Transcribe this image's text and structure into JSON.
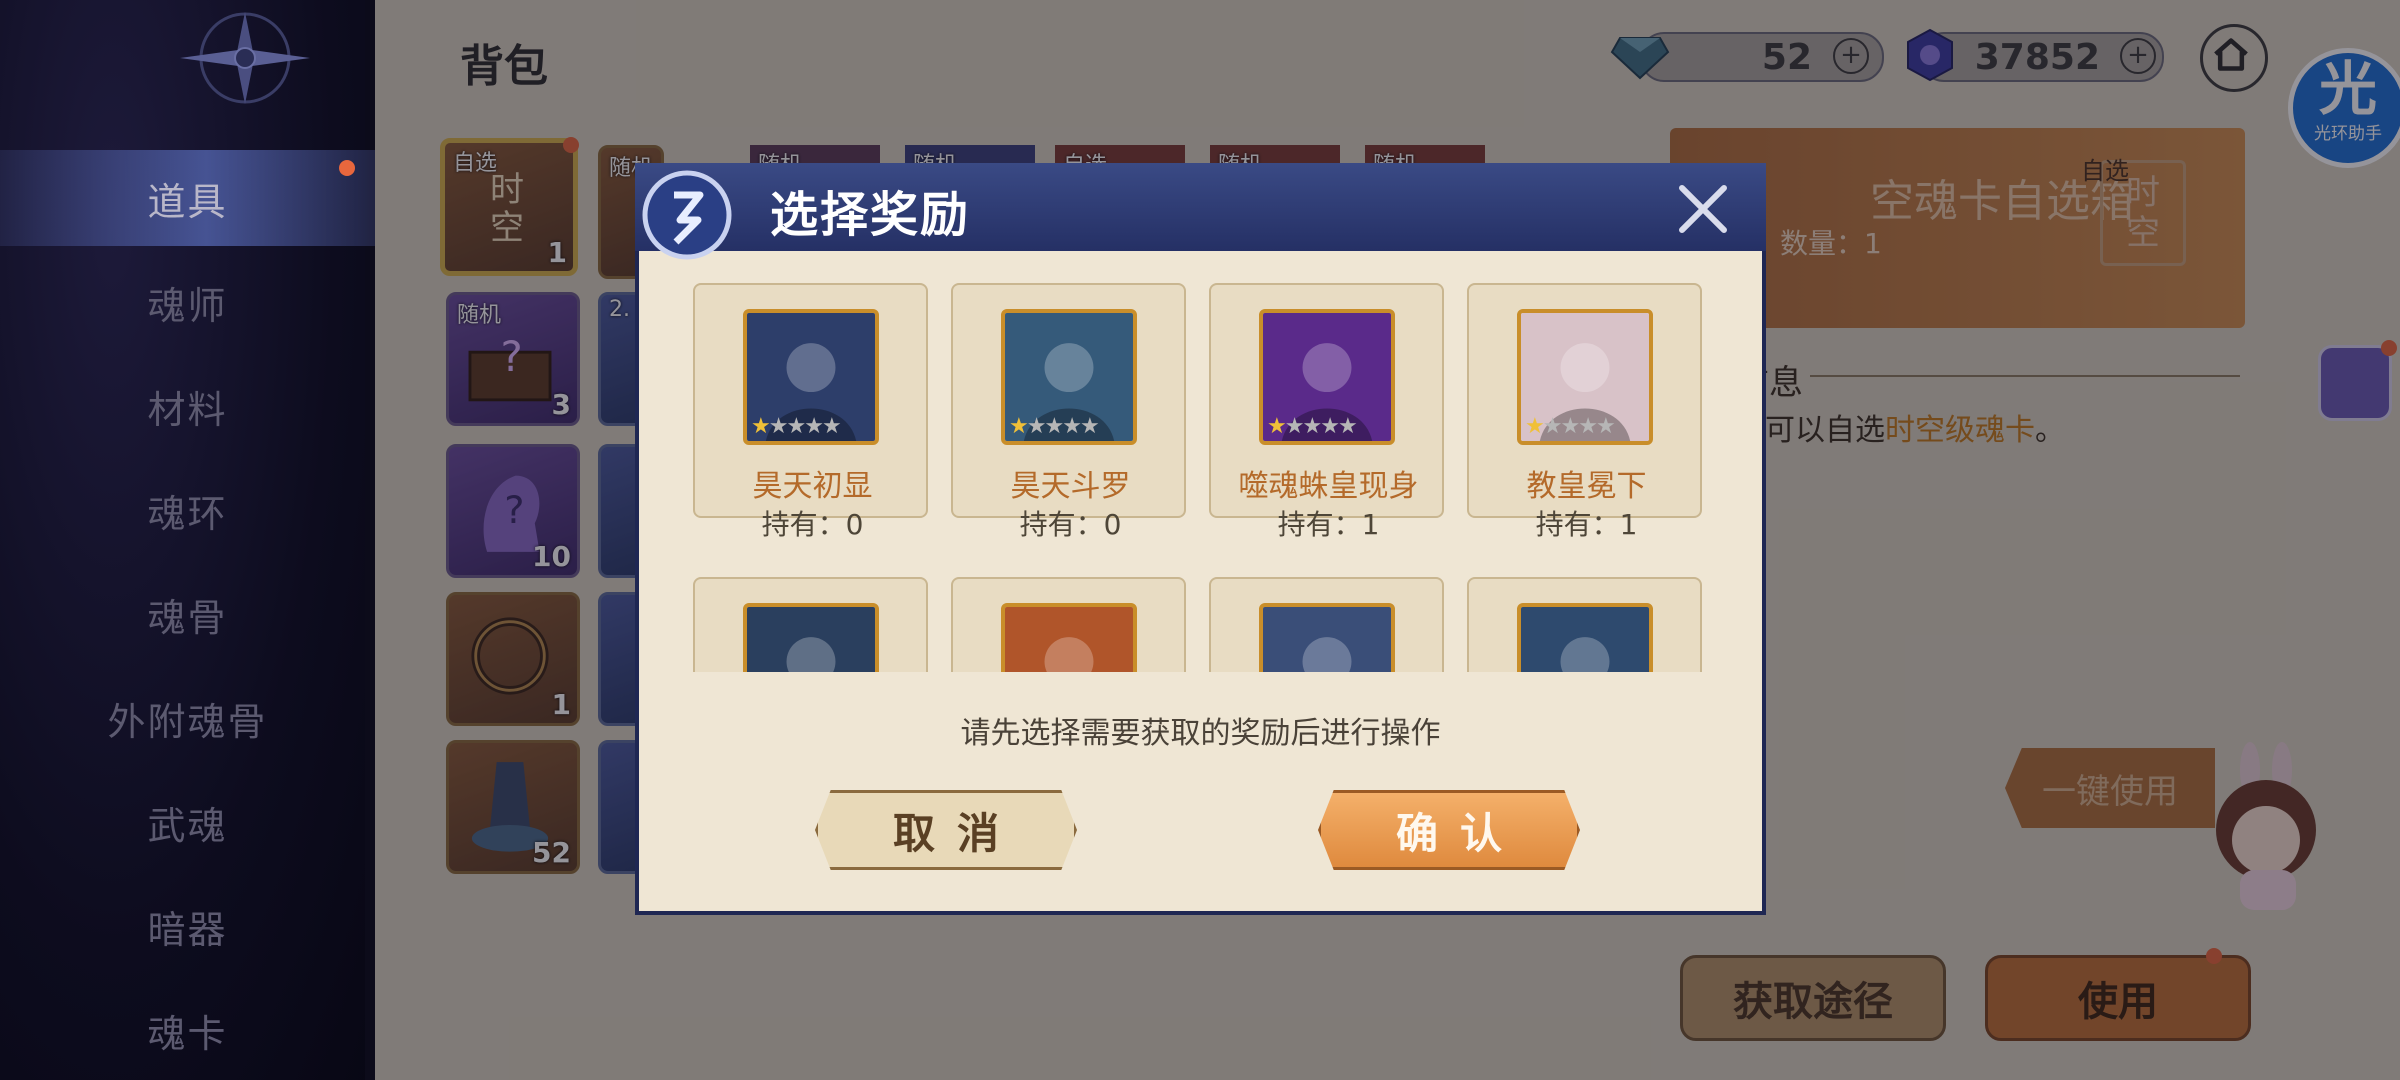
{
  "header": {
    "title": "背包"
  },
  "currency": [
    {
      "name": "diamond",
      "value": "52"
    },
    {
      "name": "soul-coin",
      "value": "37852"
    }
  ],
  "sidebar": {
    "items": [
      {
        "label": "道具",
        "active": true,
        "dot": true
      },
      {
        "label": "魂师"
      },
      {
        "label": "材料"
      },
      {
        "label": "魂环"
      },
      {
        "label": "魂骨"
      },
      {
        "label": "外附魂骨"
      },
      {
        "label": "武魂"
      },
      {
        "label": "暗器"
      },
      {
        "label": "魂卡"
      }
    ]
  },
  "inventory": {
    "items": [
      {
        "tag": "自选",
        "glyph": "时空",
        "count": "1"
      },
      {
        "tag": "随机"
      },
      {
        "tag": "随机",
        "count": "3"
      },
      {
        "tag": "",
        "count": "10"
      },
      {
        "tag": "",
        "count": "1"
      },
      {
        "tag": "",
        "count": "52"
      }
    ],
    "top_tags": [
      "随机",
      "随机",
      "随机",
      "自选",
      "随机",
      "随机"
    ],
    "partial": "2."
  },
  "detail": {
    "title": "空魂卡自选箱",
    "count_label": "数量：1",
    "badge_tag": "自选",
    "badge_glyph": "时空",
    "info_label": "信息",
    "info_prefix": "后可以自选",
    "info_highlight": "时空级魂卡",
    "info_suffix": "。"
  },
  "actions": {
    "one_key": "一键使用",
    "get_way": "获取途径",
    "use": "使用"
  },
  "assistant": {
    "big": "光",
    "small": "光环助手"
  },
  "dialog": {
    "title": "选择奖励",
    "hint": "请先选择需要获取的奖励后进行操作",
    "cancel": "取消",
    "confirm": "确认",
    "rewards": [
      {
        "name": "昊天初显",
        "hold": "持有：0",
        "stars": 1,
        "color": "#2d3e6a"
      },
      {
        "name": "昊天斗罗",
        "hold": "持有：0",
        "stars": 1,
        "color": "#355a7a"
      },
      {
        "name": "噬魂蛛皇现身",
        "hold": "持有：1",
        "stars": 1,
        "color": "#5a2a8a"
      },
      {
        "name": "教皇冕下",
        "hold": "持有：1",
        "stars": 1,
        "color": "#d8c2c8"
      }
    ],
    "rewards_row2_colors": [
      "#2a3f5e",
      "#b0552a",
      "#3a4e78",
      "#2e4a6e"
    ]
  }
}
